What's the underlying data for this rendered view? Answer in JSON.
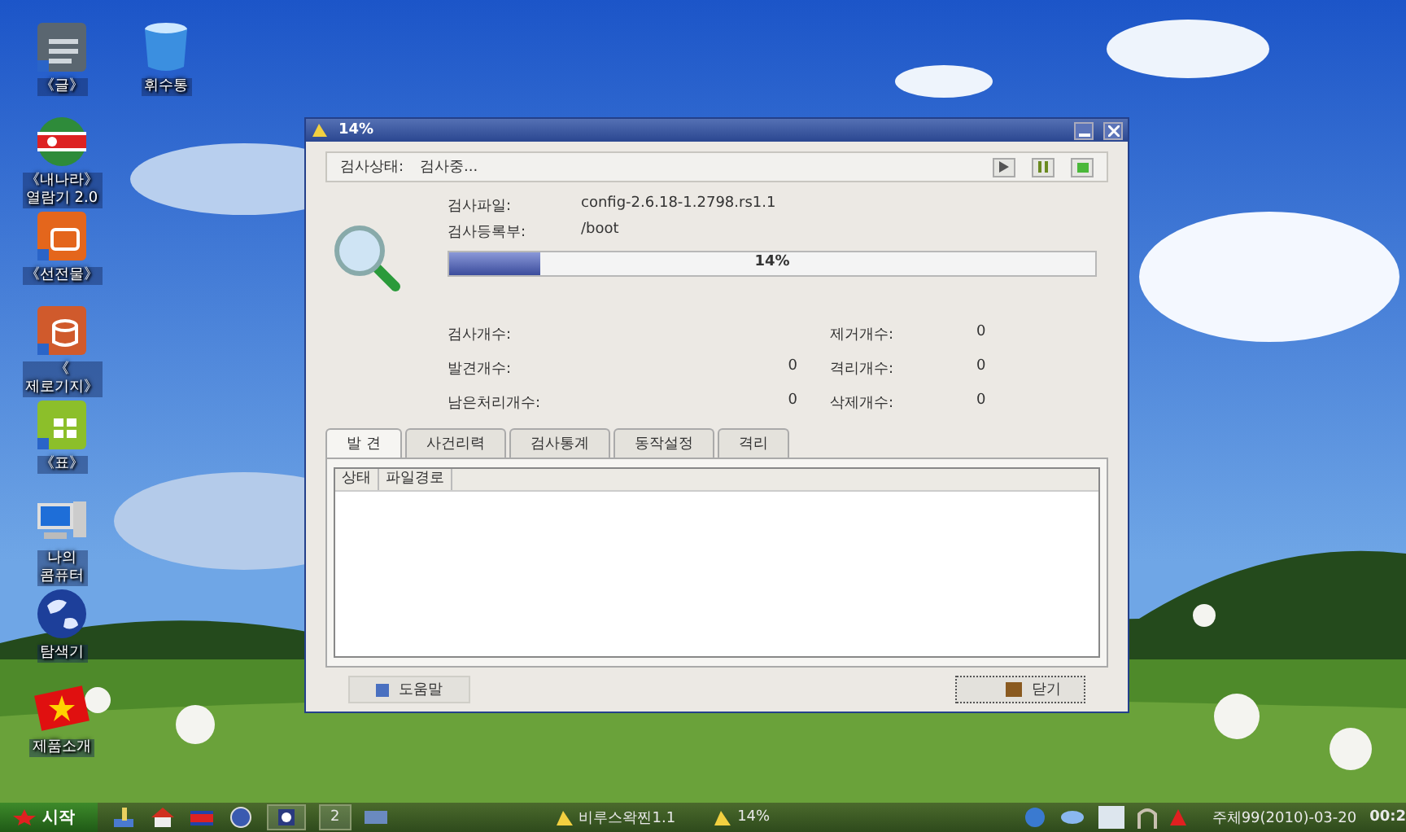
{
  "desktop_icons": [
    {
      "label": "《글》",
      "kind": "doc"
    },
    {
      "label": "휘수통",
      "kind": "bin"
    },
    {
      "label": "《내나라》\n열람기 2.0",
      "kind": "flag"
    },
    {
      "label": "《선전물》",
      "kind": "slides"
    },
    {
      "label": "《\n제로기지》",
      "kind": "db"
    },
    {
      "label": "《표》",
      "kind": "sheet"
    },
    {
      "label": "나의\n콤퓨터",
      "kind": "computer"
    },
    {
      "label": "탐색기",
      "kind": "globe"
    },
    {
      "label": "제품소개",
      "kind": "star"
    }
  ],
  "window": {
    "title": "14%",
    "status_label": "검사상태:",
    "status_value": "검사중...",
    "file_label": "검사파일:",
    "file_value": "config-2.6.18-1.2798.rs1.1",
    "dir_label": "검사등록부:",
    "dir_value": "/boot",
    "progress": {
      "level": 0.14,
      "reading": "14%"
    },
    "stats": [
      {
        "label": "검사개수:",
        "label2": "제거개수:",
        "value2": "0"
      },
      {
        "label": "발견개수:",
        "value": "0",
        "label2": "격리개수:",
        "value2": "0"
      },
      {
        "label": "남은처리개수:",
        "value": "0",
        "label2": "삭제개수:",
        "value2": "0"
      }
    ],
    "tabs": [
      {
        "label": "발 견",
        "selected": true
      },
      {
        "label": "사건리력",
        "selected": false
      },
      {
        "label": "검사통계",
        "selected": false
      },
      {
        "label": "동작설정",
        "selected": false
      },
      {
        "label": "격리",
        "selected": false
      }
    ],
    "table": {
      "columns": [
        "상태",
        "파일경로"
      ]
    },
    "buttons": {
      "help": "도움말",
      "close": "닫기"
    }
  },
  "taskbar": {
    "start": "시작",
    "workspace": "2",
    "tasks": [
      {
        "label": "비루스왁찐1.1",
        "selected": false
      },
      {
        "label": "14%",
        "selected": false
      }
    ],
    "clock": "주체99(2010)-03-20",
    "time": "00:2"
  }
}
